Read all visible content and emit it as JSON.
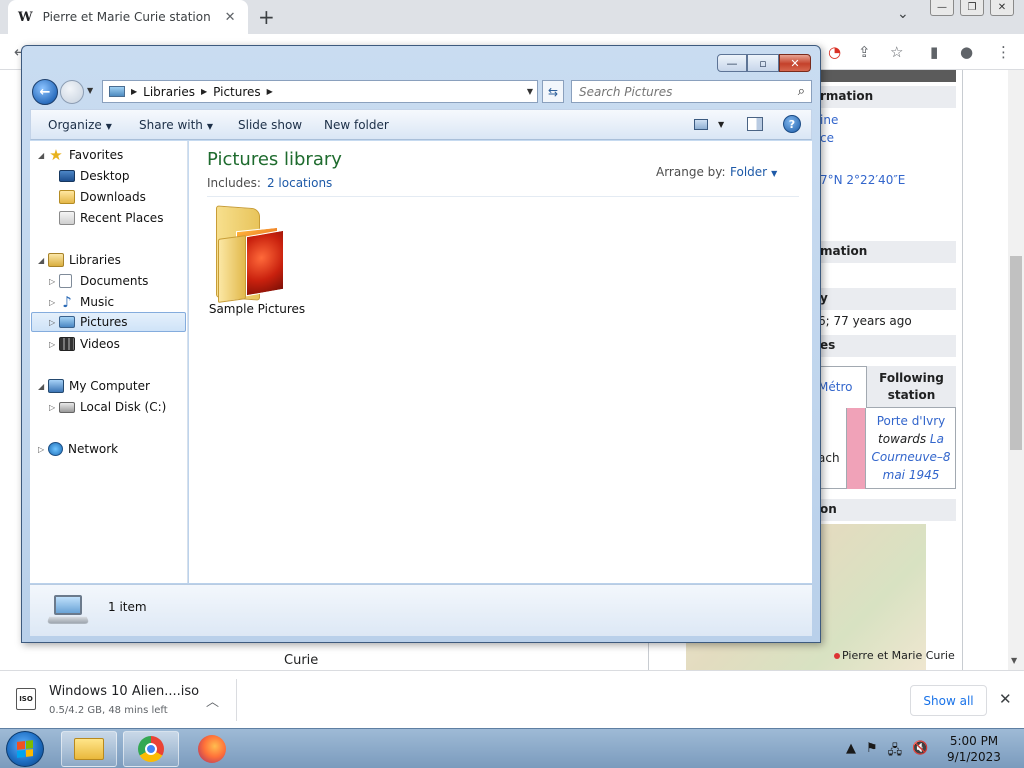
{
  "browser": {
    "tab_favicon": "W",
    "tab_title": "Pierre et Marie Curie station - Wi",
    "tab_close": "✕",
    "new_tab": "+",
    "tab_list": "⌄",
    "window_controls": [
      "—",
      "❐",
      "✕"
    ]
  },
  "wiki": {
    "infobox_headers": [
      "rmation",
      "mation",
      "y",
      "es",
      "on"
    ],
    "links": [
      "ine",
      "ce"
    ],
    "coordinates": "7°N 2°22′40″E",
    "opened": "6; 77 years ago",
    "metro_link": "Métro",
    "following_header": "Following station",
    "following_station": "Porte d'Ivry",
    "towards_word": "towards",
    "towards_dest": "La Courneuve–8 mai 1945",
    "row_text": "ach",
    "map_label": "Pierre et Marie Curie",
    "page_caption": "Curie"
  },
  "downloads": {
    "icon_text": "ISO",
    "file_name": "Windows 10 Alien....iso",
    "progress": "0.5/4.2 GB, 48 mins left",
    "show_all": "Show all",
    "close": "✕"
  },
  "explorer": {
    "caption_buttons": {
      "minimize": "—",
      "maximize": "▫",
      "close": "✕"
    },
    "breadcrumb": [
      "Libraries",
      "Pictures"
    ],
    "search_placeholder": "Search Pictures",
    "commands": {
      "organize": "Organize",
      "share_with": "Share with",
      "slide_show": "Slide show",
      "new_folder": "New folder"
    },
    "nav": {
      "favorites": "Favorites",
      "desktop": "Desktop",
      "downloads": "Downloads",
      "recent_places": "Recent Places",
      "libraries": "Libraries",
      "documents": "Documents",
      "music": "Music",
      "pictures": "Pictures",
      "videos": "Videos",
      "my_computer": "My Computer",
      "local_disk": "Local Disk (C:)",
      "network": "Network"
    },
    "library": {
      "title": "Pictures library",
      "includes_label": "Includes:",
      "locations_link": "2 locations",
      "arrange_label": "Arrange by:",
      "arrange_value": "Folder"
    },
    "items": [
      {
        "name": "Sample Pictures"
      }
    ],
    "status": {
      "item_count": "1 item"
    },
    "colors": {
      "library_title": "#1e6b2e",
      "link": "#1e5aa8",
      "close_button": "#c4412a"
    }
  },
  "taskbar": {
    "clock_time": "5:00 PM",
    "clock_date": "9/1/2023",
    "tray": [
      "▲",
      "⚑",
      "🖧",
      "🔇"
    ]
  }
}
